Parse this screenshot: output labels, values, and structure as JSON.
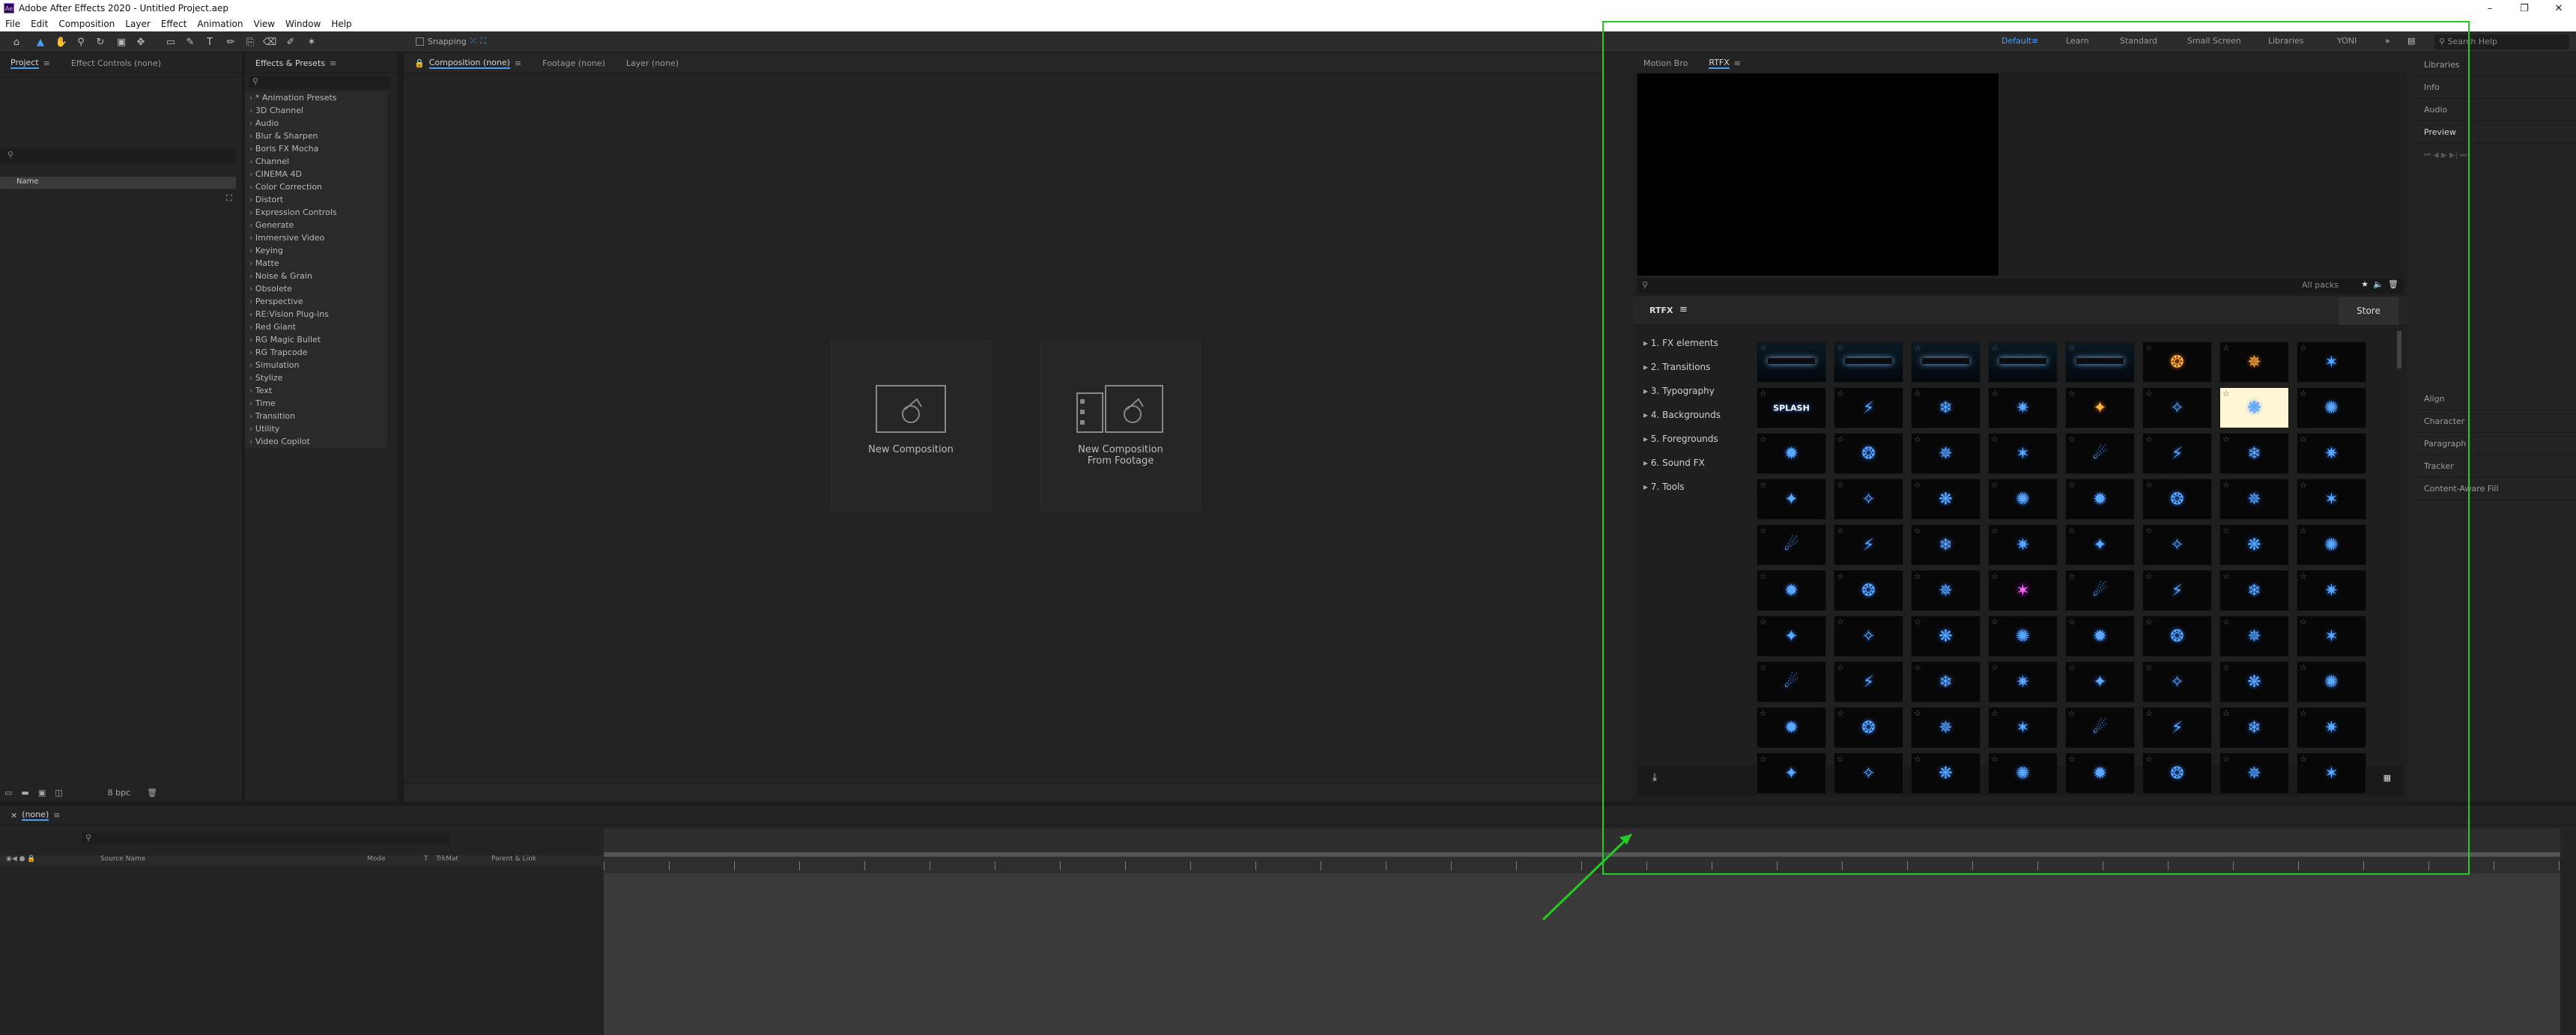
{
  "window": {
    "title": "Adobe After Effects 2020 - Untitled Project.aep",
    "controls": [
      "–",
      "❐",
      "✕"
    ]
  },
  "menu": [
    "File",
    "Edit",
    "Composition",
    "Layer",
    "Effect",
    "Animation",
    "View",
    "Window",
    "Help"
  ],
  "toolbar": {
    "snapping_label": "Snapping",
    "workspaces": [
      "Default",
      "Learn",
      "Standard",
      "Small Screen",
      "Libraries",
      "YONI"
    ],
    "active_workspace": "Default",
    "search_help_placeholder": "Search Help"
  },
  "project_panel": {
    "tabs": [
      "Project",
      "Effect Controls (none)"
    ],
    "name_column": "Name",
    "bpc": "8 bpc"
  },
  "effects_panel": {
    "tab": "Effects & Presets",
    "categories": [
      "* Animation Presets",
      "3D Channel",
      "Audio",
      "Blur & Sharpen",
      "Boris FX Mocha",
      "Channel",
      "CINEMA 4D",
      "Color Correction",
      "Distort",
      "Expression Controls",
      "Generate",
      "Immersive Video",
      "Keying",
      "Matte",
      "Noise & Grain",
      "Obsolete",
      "Perspective",
      "RE:Vision Plug-ins",
      "Red Giant",
      "RG Magic Bullet",
      "RG Trapcode",
      "Simulation",
      "Stylize",
      "Text",
      "Time",
      "Transition",
      "Utility",
      "Video Copilot"
    ]
  },
  "viewer": {
    "tabs": [
      "Composition (none)",
      "Footage (none)",
      "Layer (none)"
    ],
    "new_composition": "New Composition",
    "new_from_footage_line1": "New Composition",
    "new_from_footage_line2": "From Footage"
  },
  "rtfx_panel": {
    "tabs": [
      "Motion Bro",
      "RTFX"
    ],
    "packs_label": "All packs",
    "header": "RTFX",
    "store_button": "Store",
    "categories": [
      "1. FX elements",
      "2. Transitions",
      "3. Typography",
      "4. Backgrounds",
      "5. Foregrounds",
      "6. Sound FX",
      "7. Tools"
    ],
    "splash_text": "SPLASH"
  },
  "right_panels": {
    "items": [
      "Libraries",
      "Info",
      "Audio",
      "Preview",
      "Align",
      "Character",
      "Paragraph",
      "Tracker",
      "Content-Aware Fill"
    ]
  },
  "timeline": {
    "tab": "(none)",
    "columns": [
      "Source Name",
      "Mode",
      "T",
      "TrkMat",
      "Parent & Link"
    ]
  },
  "colors": {
    "accent": "#4a9ff5",
    "highlight_box": "#22cc22",
    "panel_bg": "#232323"
  }
}
